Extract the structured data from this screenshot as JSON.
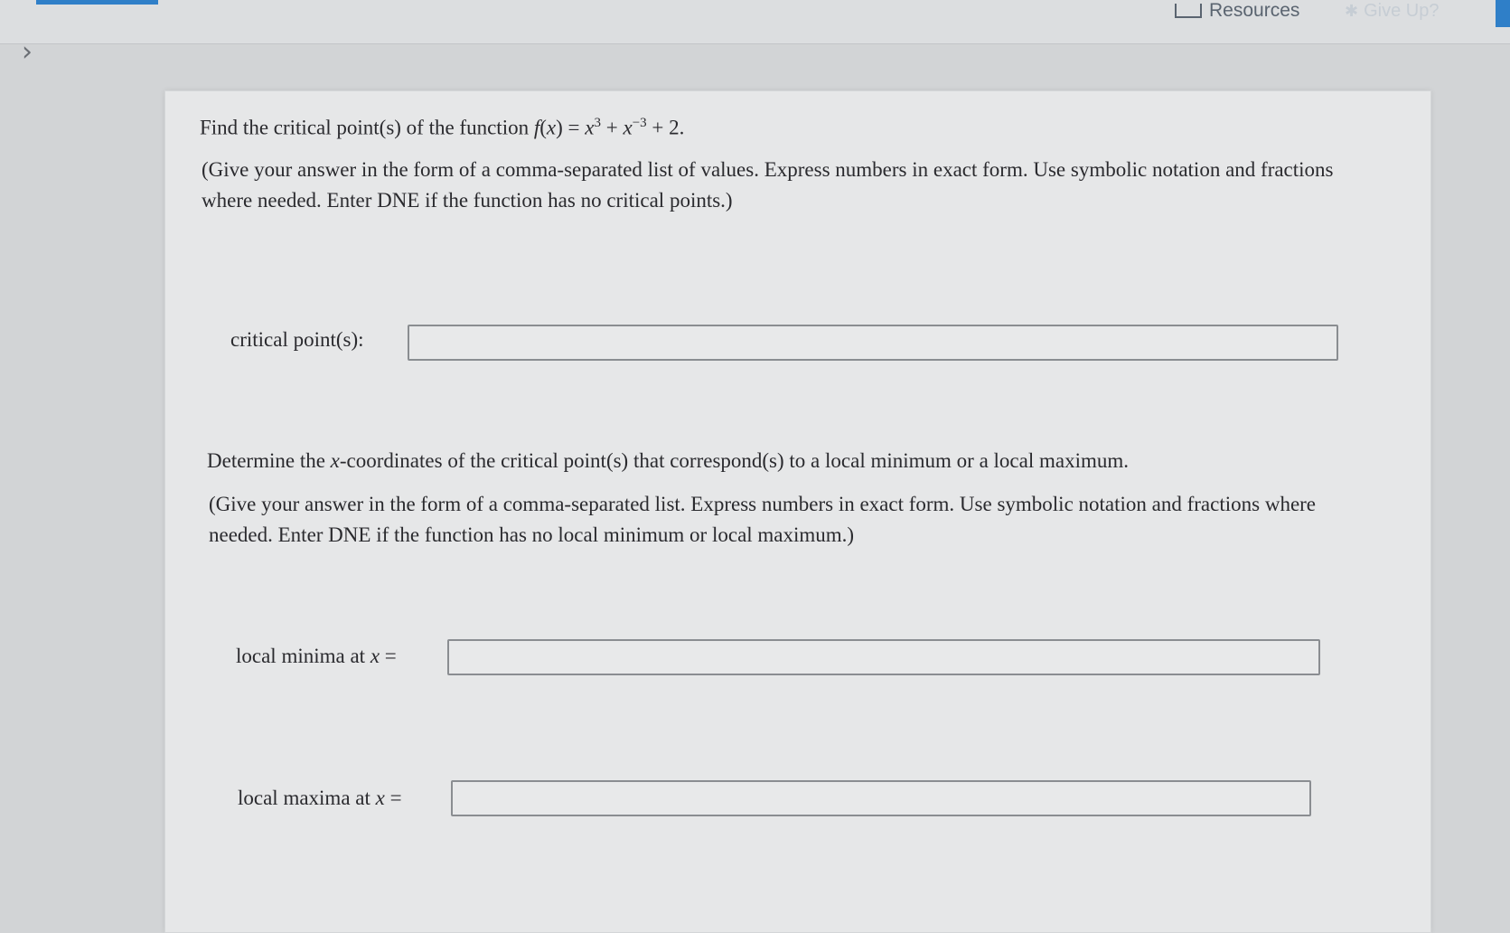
{
  "header": {
    "resources_label": "Resources",
    "giveup_label": "Give Up?"
  },
  "question1": {
    "prompt_prefix": "Find the critical point(s) of the function ",
    "function_name": "f",
    "function_arg": "x",
    "term1_base": "x",
    "term1_exp": "3",
    "term2_base": "x",
    "term2_exp": "−3",
    "constant": "2",
    "instructions": "(Give your answer in the form of a comma-separated list of values. Express numbers in exact form. Use symbolic notation and fractions where needed. Enter DNE if the function has no critical points.)",
    "field_label": "critical point(s):",
    "field_value": ""
  },
  "question2": {
    "prompt_prefix": "Determine the ",
    "prompt_var": "x",
    "prompt_suffix": "-coordinates of the critical point(s) that correspond(s) to a local minimum or a local maximum.",
    "instructions": "(Give your answer in the form of a comma-separated list. Express numbers in exact form. Use symbolic notation and fractions where needed. Enter DNE if the function has no local minimum or local maximum.)",
    "minima_label": "local minima at ",
    "minima_var": "x",
    "minima_value": "",
    "maxima_label": "local maxima at ",
    "maxima_var": "x",
    "maxima_value": ""
  }
}
